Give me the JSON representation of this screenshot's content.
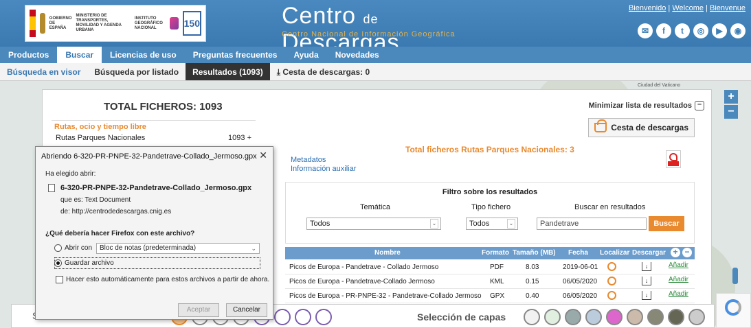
{
  "header": {
    "gov_text": [
      "GOBIERNO DE ESPAÑA",
      "MINISTERIO DE TRANSPORTES, MOVILIDAD Y AGENDA URBANA",
      "INSTITUTO GEOGRÁFICO NACIONAL"
    ],
    "logo_150": "150",
    "title_part1": "Centro",
    "title_de": "de",
    "title_part2": "Descargas",
    "subtitle": "Centro Nacional de Información Geográfica",
    "links": [
      "Bienvenido",
      "Welcome",
      "Bienvenue"
    ],
    "social_icons": [
      "mail-icon",
      "facebook-icon",
      "twitter-icon",
      "instagram-icon",
      "youtube-icon",
      "rss-icon"
    ]
  },
  "nav": {
    "items": [
      "Productos",
      "Buscar",
      "Licencias de uso",
      "Preguntas frecuentes",
      "Ayuda",
      "Novedades"
    ],
    "active": "Buscar"
  },
  "subnav": {
    "items": [
      "Búsqueda en visor",
      "Búsqueda por listado",
      "Resultados (1093)",
      "Cesta de descargas: 0"
    ]
  },
  "map": {
    "label": "Ciudad del Vaticano",
    "zoom_in": "+",
    "zoom_out": "−"
  },
  "results": {
    "total": "TOTAL FICHEROS: 1093",
    "minimize": "Minimizar lista de resultados",
    "category_head": "Rutas, ocio y tiempo libre",
    "category_item": "Rutas Parques Nacionales",
    "category_count": "1093 +",
    "cesta": "Cesta de descargas",
    "total_files": "Total ficheros  Rutas Parques Nacionales: 3",
    "metadatos": "Metadatos",
    "info_aux": "Información auxiliar",
    "filter_title": "Filtro sobre los resultados",
    "lbl_tematica": "Temática",
    "lbl_tipo": "Tipo fichero",
    "lbl_buscar": "Buscar en resultados",
    "sel_tematica": "Todos",
    "sel_tipo": "Todos",
    "search_value": "Pandetrave",
    "search_button": "Buscar",
    "columns": [
      "Nombre",
      "Formato",
      "Tamaño (MB)",
      "Fecha",
      "Localizar",
      "Descargar"
    ],
    "rows": [
      {
        "nombre": "Picos de Europa - Pandetrave - Collado Jermoso",
        "formato": "PDF",
        "tamano": "8.03",
        "fecha": "2019-06-01",
        "add": "Añadir"
      },
      {
        "nombre": "Picos de Europa - Pandetrave-Collado Jermoso",
        "formato": "KML",
        "tamano": "0.15",
        "fecha": "06/05/2020",
        "add": "Añadir"
      },
      {
        "nombre": "Picos de Europa - PR-PNPE-32 - Pandetrave-Collado Jermoso",
        "formato": "GPX",
        "tamano": "0.40",
        "fecha": "06/05/2020",
        "add": "Añadir"
      }
    ]
  },
  "bottombar": {
    "left_text": "S",
    "capas": "Selección de capas"
  },
  "dialog": {
    "title": "Abriendo 6-320-PR-PNPE-32-Pandetrave-Collado_Jermoso.gpx",
    "chosen": "Ha elegido abrir:",
    "filename": "6-320-PR-PNPE-32-Pandetrave-Collado_Jermoso.gpx",
    "que_es": "que es:  Text Document",
    "de": "de:  http://centrodedescargas.cnig.es",
    "question": "¿Qué debería hacer Firefox con este archivo?",
    "abrir_con": "Abrir con",
    "app": "Bloc de notas (predeterminada)",
    "guardar": "Guardar archivo",
    "auto": "Hacer esto automáticamente para estos archivos a partir de ahora.",
    "aceptar": "Aceptar",
    "cancelar": "Cancelar"
  }
}
